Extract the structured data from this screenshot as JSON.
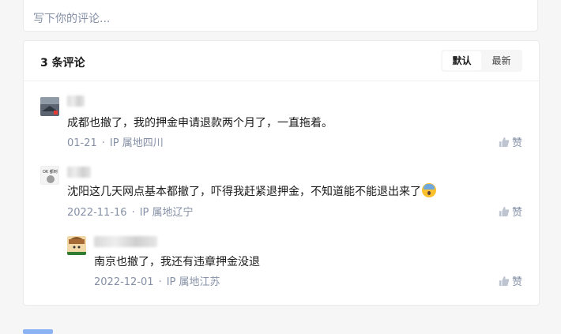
{
  "comment_input": {
    "placeholder": "写下你的评论..."
  },
  "comments_section": {
    "count_label": "3 条评论",
    "sort_options": [
      "默认",
      "最新"
    ],
    "selected_sort": "默认",
    "comments": [
      {
        "text": "成都也撤了，我的押金申请退款两个月了，一直拖着。",
        "date": "01-21",
        "location": "IP 属地四川",
        "like_label": "赞"
      },
      {
        "text": "沈阳这几天网点基本都撤了，吓得我赶紧退押金，不知道能不能退出来了",
        "date": "2022-11-16",
        "location": "IP 属地辽宁",
        "like_label": "赞",
        "avatar_text": "OK 都到"
      },
      {
        "text": "南京也撤了，我还有违章押金没退",
        "date": "2022-12-01",
        "location": "IP 属地江苏",
        "like_label": "赞"
      }
    ]
  },
  "colors": {
    "meta": "#8590a6",
    "text": "#1a1a1a",
    "accent": "#056de8"
  },
  "icons": {
    "like": "thumb-up-icon",
    "emoji": "fearful-face-emoji"
  }
}
